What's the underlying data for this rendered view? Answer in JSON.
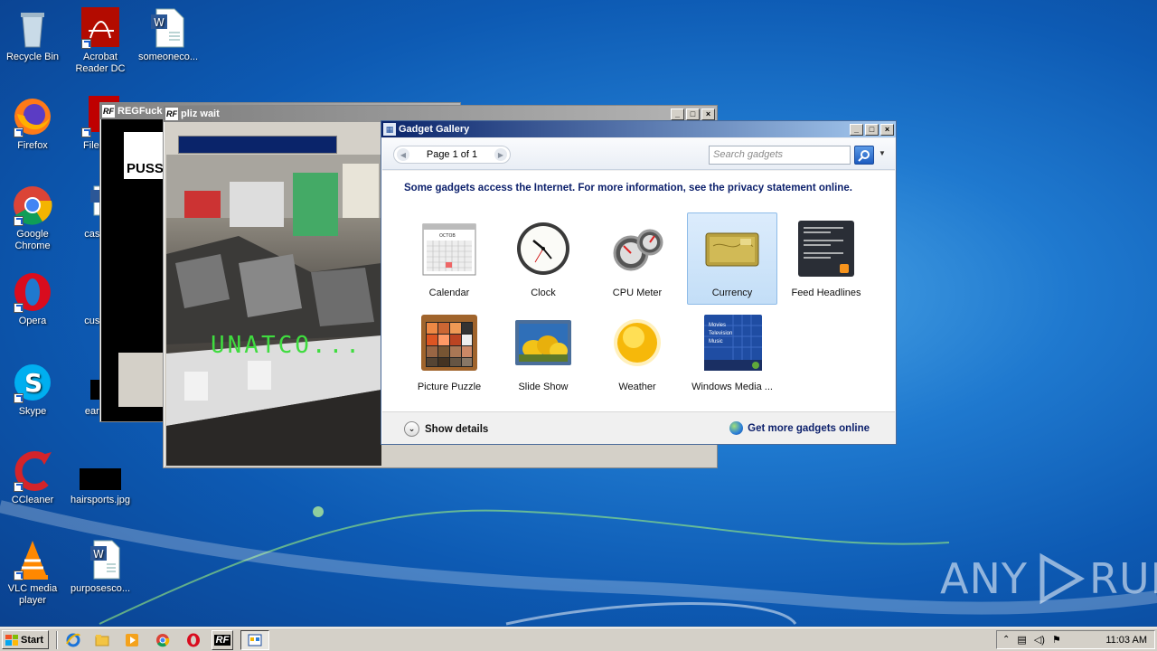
{
  "desktop_icons": [
    {
      "label": "Recycle Bin",
      "icon": "recycle-bin-icon"
    },
    {
      "label": "Acrobat Reader DC",
      "icon": "acrobat-icon"
    },
    {
      "label": "someoneco...",
      "icon": "word-doc-icon"
    },
    {
      "label": "Firefox",
      "icon": "firefox-icon"
    },
    {
      "label": "FileZilla",
      "icon": "filezilla-icon"
    },
    {
      "label": "Google Chrome",
      "icon": "chrome-icon"
    },
    {
      "label": "caseab",
      "icon": "word-doc-icon"
    },
    {
      "label": "Opera",
      "icon": "opera-icon"
    },
    {
      "label": "custom",
      "icon": "file-icon"
    },
    {
      "label": "Skype",
      "icon": "skype-icon"
    },
    {
      "label": "earthm",
      "icon": "image-icon"
    },
    {
      "label": "CCleaner",
      "icon": "ccleaner-icon"
    },
    {
      "label": "hairsports.jpg",
      "icon": "image-icon"
    },
    {
      "label": "VLC media player",
      "icon": "vlc-icon"
    },
    {
      "label": "purposesco...",
      "icon": "word-doc-icon"
    }
  ],
  "back_window": {
    "title": "REGFuck",
    "text": "PUSS"
  },
  "wait_window": {
    "title": "pliz wait",
    "overlay_text": "UNATCO..."
  },
  "gadget_gallery": {
    "title": "Gadget Gallery",
    "page_label": "Page 1 of 1",
    "search_placeholder": "Search gadgets",
    "notice": "Some gadgets access the Internet.  For more information, see the privacy statement online.",
    "gadgets": [
      {
        "label": "Calendar",
        "icon": "calendar-icon",
        "selected": false
      },
      {
        "label": "Clock",
        "icon": "clock-icon",
        "selected": false
      },
      {
        "label": "CPU Meter",
        "icon": "cpu-meter-icon",
        "selected": false
      },
      {
        "label": "Currency",
        "icon": "currency-icon",
        "selected": true
      },
      {
        "label": "Feed Headlines",
        "icon": "feed-headlines-icon",
        "selected": false
      },
      {
        "label": "Picture Puzzle",
        "icon": "picture-puzzle-icon",
        "selected": false
      },
      {
        "label": "Slide Show",
        "icon": "slide-show-icon",
        "selected": false
      },
      {
        "label": "Weather",
        "icon": "weather-icon",
        "selected": false
      },
      {
        "label": "Windows Media ...",
        "icon": "windows-media-icon",
        "selected": false
      }
    ],
    "calendar_month": "OCTOB",
    "media_lines": [
      "Movies",
      "Television",
      "Music"
    ],
    "show_details": "Show details",
    "get_more": "Get more gadgets online"
  },
  "taskbar": {
    "start_label": "Start",
    "clock": "11:03 AM"
  },
  "watermark": {
    "left": "ANY",
    "right": "RUN"
  },
  "colors": {
    "title_active": "#0a246a",
    "title_inactive": "#808080",
    "desktop": "#1f79cf",
    "notice_text": "#0b1f6b"
  }
}
